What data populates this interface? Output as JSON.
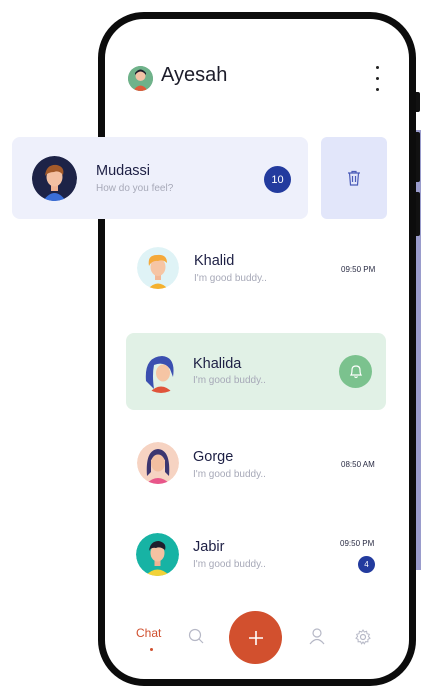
{
  "header": {
    "title": "Ayesah"
  },
  "chats": [
    {
      "name": "Mudassi",
      "preview": "How do you feel?",
      "unread": "10"
    },
    {
      "name": "Khalid",
      "preview": "I'm good buddy..",
      "time": "09:50 PM"
    },
    {
      "name": "Khalida",
      "preview": "I'm good buddy.."
    },
    {
      "name": "Gorge",
      "preview": "I'm good buddy..",
      "time": "08:50 AM"
    },
    {
      "name": "Jabir",
      "preview": "I'm good buddy..",
      "time": "09:50 PM",
      "unread": "4"
    }
  ],
  "nav": {
    "chat_label": "Chat"
  },
  "colors": {
    "accent": "#d2502e",
    "badge": "#233b9e",
    "swipe_bg": "#eef0fb",
    "highlight_bg": "#e1f1e6"
  }
}
